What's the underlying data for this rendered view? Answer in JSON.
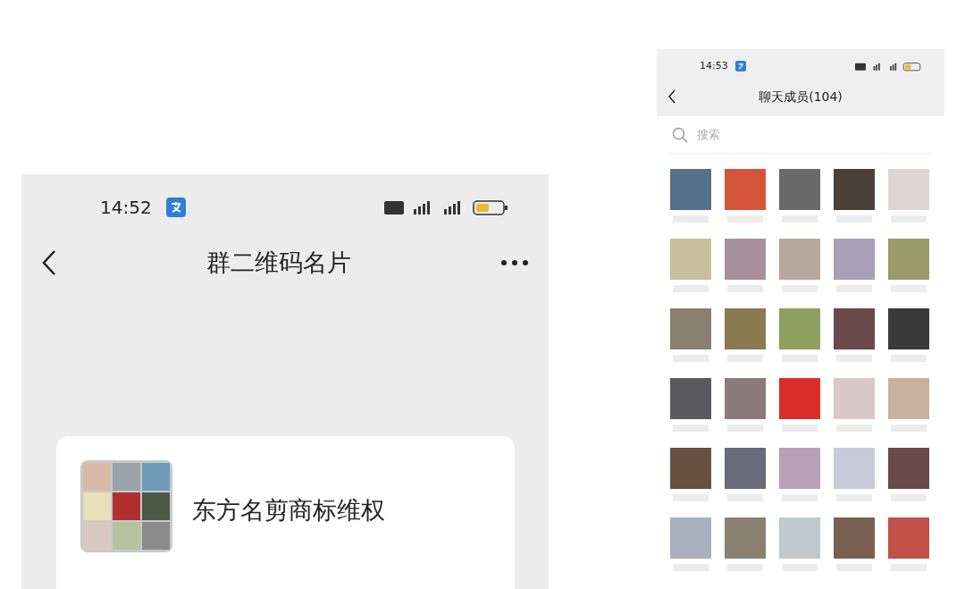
{
  "group_card_screen": {
    "status_bar": {
      "time": "14:52"
    },
    "title": "群二维码名片",
    "group": {
      "name": "东方名剪商标维权"
    }
  },
  "members_screen": {
    "status_bar": {
      "time": "14:53"
    },
    "title": "聊天成员(104)",
    "search": {
      "placeholder": "搜索"
    }
  }
}
